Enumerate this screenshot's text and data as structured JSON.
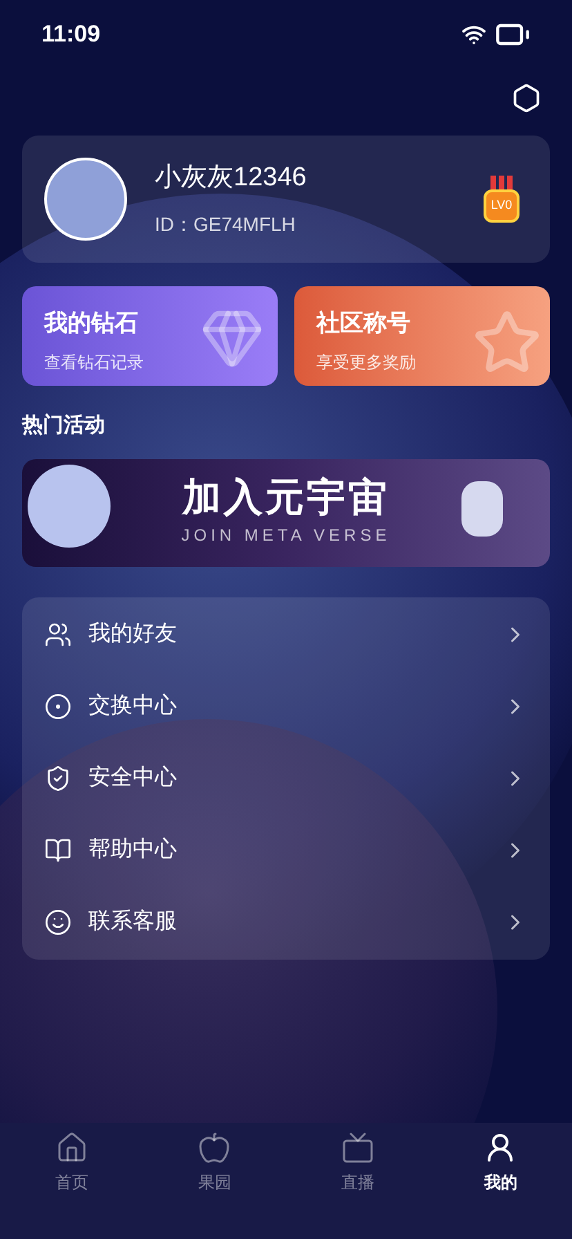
{
  "status_bar": {
    "time": "11:09"
  },
  "profile": {
    "name": "小灰灰12346",
    "id": "ID：GE74MFLH",
    "badge": "LV0"
  },
  "cards": [
    {
      "kind": "diamond",
      "title": "我的钻石",
      "subtitle": "查看钻石记录"
    },
    {
      "kind": "title",
      "title": "社区称号",
      "subtitle": "享受更多奖励"
    }
  ],
  "section_title": "热门活动",
  "banner": {
    "title": "加入元宇宙",
    "subtitle": "JOIN META VERSE"
  },
  "menu": [
    {
      "kind": "friends",
      "label": "我的好友"
    },
    {
      "kind": "exchange",
      "label": "交换中心"
    },
    {
      "kind": "security",
      "label": "安全中心"
    },
    {
      "kind": "help",
      "label": "帮助中心"
    },
    {
      "kind": "service",
      "label": "联系客服"
    }
  ],
  "tab_bar": [
    {
      "kind": "home",
      "label": "首页",
      "selected": false
    },
    {
      "kind": "orchard",
      "label": "果园",
      "selected": false
    },
    {
      "kind": "live",
      "label": "直播",
      "selected": false
    },
    {
      "kind": "mine",
      "label": "我的",
      "selected": true
    }
  ]
}
